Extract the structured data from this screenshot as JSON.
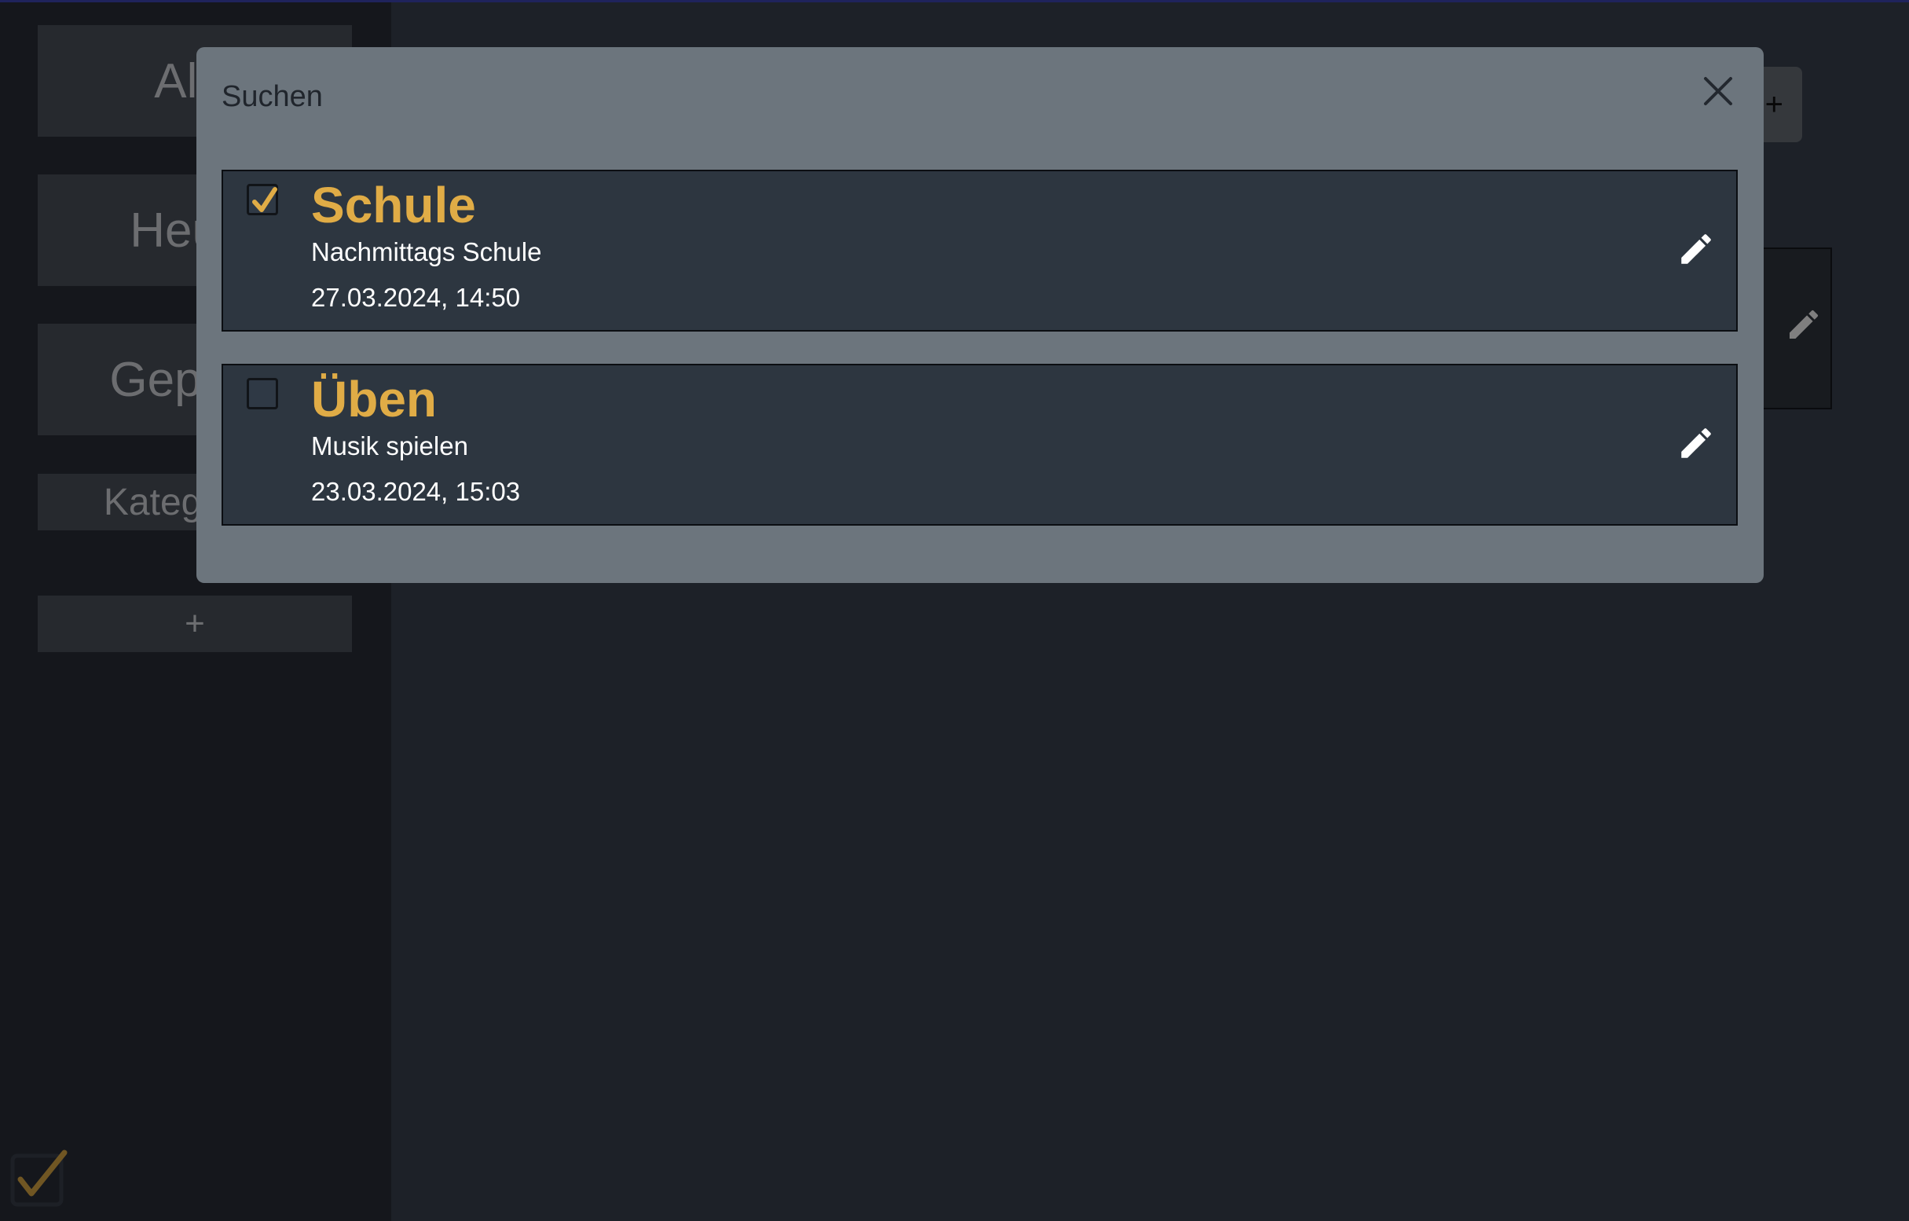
{
  "sidebar": {
    "items": [
      {
        "label": "Alle"
      },
      {
        "label": "Heute"
      },
      {
        "label": "Geplant"
      },
      {
        "label": "Kategorien"
      }
    ],
    "add_label": "+"
  },
  "main": {
    "add_button_label": "+"
  },
  "modal": {
    "title": "Suchen",
    "tasks": [
      {
        "title": "Schule",
        "description": "Nachmittags Schule",
        "date": "27.03.2024, 14:50",
        "done": true
      },
      {
        "title": "Üben",
        "description": "Musik spielen",
        "date": "23.03.2024, 15:03",
        "done": false
      }
    ]
  },
  "colors": {
    "accent": "#e0ac46",
    "modal_bg": "#6c757d",
    "card_bg": "#2d3640",
    "app_bg": "#1e232b"
  },
  "icons": [
    "close-icon",
    "pencil-icon",
    "check-icon",
    "app-logo-check-icon"
  ]
}
